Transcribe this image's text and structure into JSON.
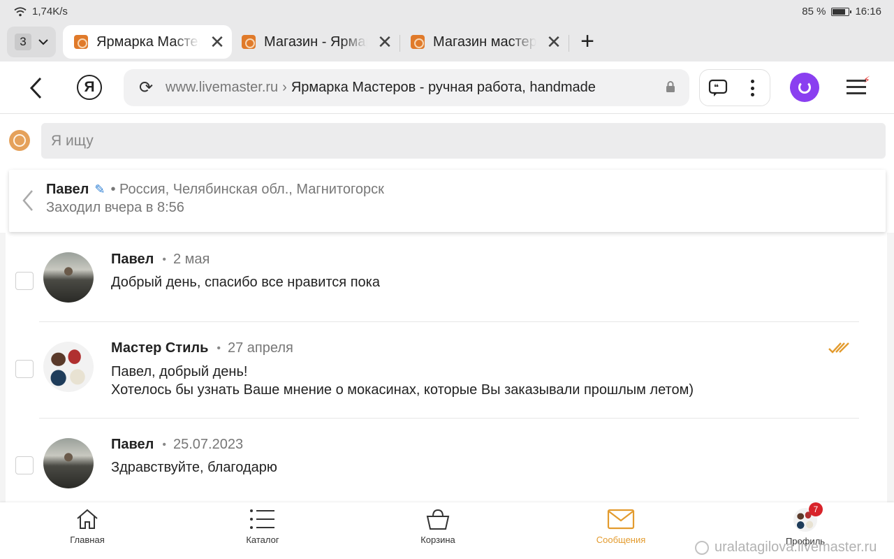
{
  "status_bar": {
    "network_speed": "1,74K/s",
    "battery": "85 %",
    "battery_level": 0.85,
    "time": "16:16"
  },
  "tabs": {
    "count": "3",
    "items": [
      {
        "title": "Ярмарка Мастеров",
        "active": true
      },
      {
        "title": "Магазин - Ярмарка",
        "active": false
      },
      {
        "title": "Магазин мастера",
        "active": false
      }
    ]
  },
  "address_bar": {
    "domain": "www.livemaster.ru",
    "separator": "›",
    "page_title": "Ярмарка Мастеров - ручная работа, handmade",
    "yandex_logo": "Я"
  },
  "search": {
    "placeholder": "Я ищу"
  },
  "chat_header": {
    "name": "Павел",
    "location": "• Россия, Челябинская обл., Магнитогорск",
    "last_seen": "Заходил вчера в 8:56"
  },
  "messages": [
    {
      "author": "Павел",
      "date": "2 мая",
      "text": "Добрый день, спасибо все нравится пока",
      "avatar": "man",
      "read": false
    },
    {
      "author": "Мастер Стиль",
      "date": "27 апреля",
      "text": "Павел, добрый день!\nХотелось бы узнать Ваше мнение о мокасинах, которые Вы заказывали прошлым летом)",
      "avatar": "shoes",
      "read": true
    },
    {
      "author": "Павел",
      "date": "25.07.2023",
      "text": "Здравствуйте, благодарю",
      "avatar": "man",
      "read": false
    }
  ],
  "bottom_nav": [
    {
      "label": "Главная",
      "icon": "home-icon"
    },
    {
      "label": "Каталог",
      "icon": "list-icon"
    },
    {
      "label": "Корзина",
      "icon": "basket-icon"
    },
    {
      "label": "Сообщения",
      "icon": "mail-icon",
      "active": true
    },
    {
      "label": "Профиль",
      "icon": "avatar",
      "badge": "7"
    }
  ],
  "watermark": "uralatagilova.livemaster.ru",
  "colors": {
    "accent": "#e39b2e",
    "alice": "#8a3ff0",
    "badge": "#d8232a",
    "link_blue": "#2d7fd4"
  }
}
